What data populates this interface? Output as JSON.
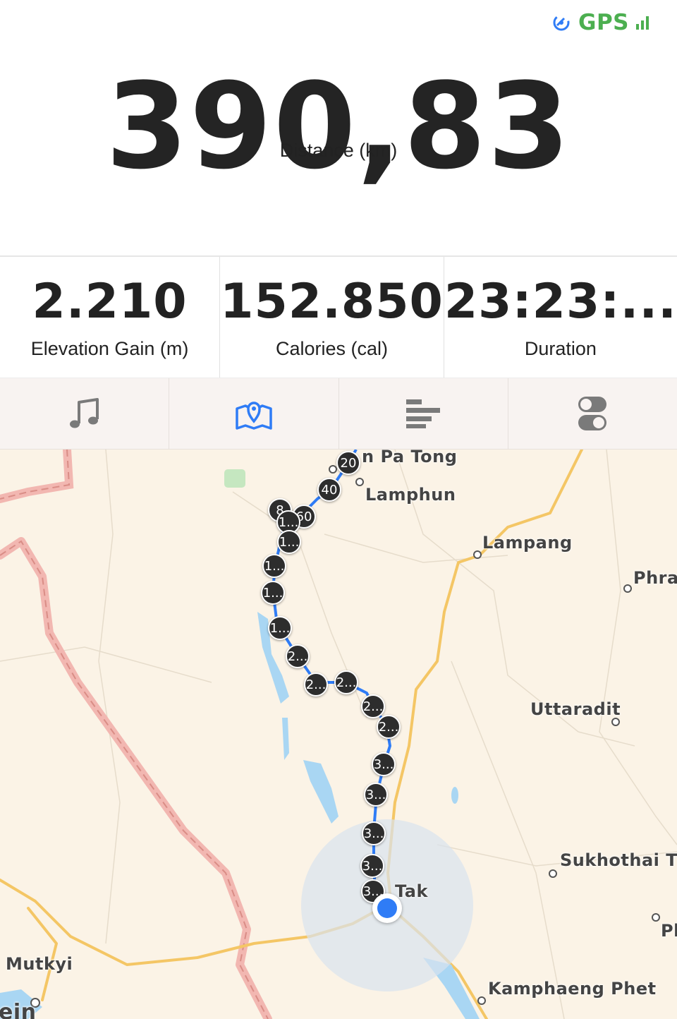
{
  "status": {
    "gps_label": "GPS",
    "gps_icon": "satellite-icon",
    "signal_icon": "signal-bars-icon",
    "accent_color": "#4caf50"
  },
  "distance": {
    "value": "390,83",
    "label": "Distance (km)"
  },
  "stats": [
    {
      "value": "2.210",
      "label": "Elevation Gain (m)"
    },
    {
      "value": "152.850",
      "label": "Calories (cal)"
    },
    {
      "value": "23:23:...",
      "label": "Duration"
    }
  ],
  "tabs": [
    {
      "icon": "music-note-icon",
      "active": false
    },
    {
      "icon": "map-pin-icon",
      "active": true
    },
    {
      "icon": "splits-bars-icon",
      "active": false
    },
    {
      "icon": "toggles-icon",
      "active": false
    }
  ],
  "tab_active_color": "#2f7cf6",
  "map": {
    "places": [
      {
        "name": "n Pa Tong"
      },
      {
        "name": "Lamphun"
      },
      {
        "name": "Lampang"
      },
      {
        "name": "Phrae"
      },
      {
        "name": "Uttaradit"
      },
      {
        "name": "Sukhothai Th"
      },
      {
        "name": "Tak"
      },
      {
        "name": "Kamphaeng Phet"
      },
      {
        "name": "Mutkyi"
      },
      {
        "name": "Ph"
      },
      {
        "name": "ein"
      }
    ],
    "markers": [
      "20",
      "40",
      "8",
      "60",
      "1...",
      "1...",
      "1...",
      "1...",
      "1...",
      "2...",
      "2...",
      "2...",
      "2...",
      "2...",
      "3...",
      "3...",
      "3...",
      "3...",
      "3..."
    ]
  }
}
